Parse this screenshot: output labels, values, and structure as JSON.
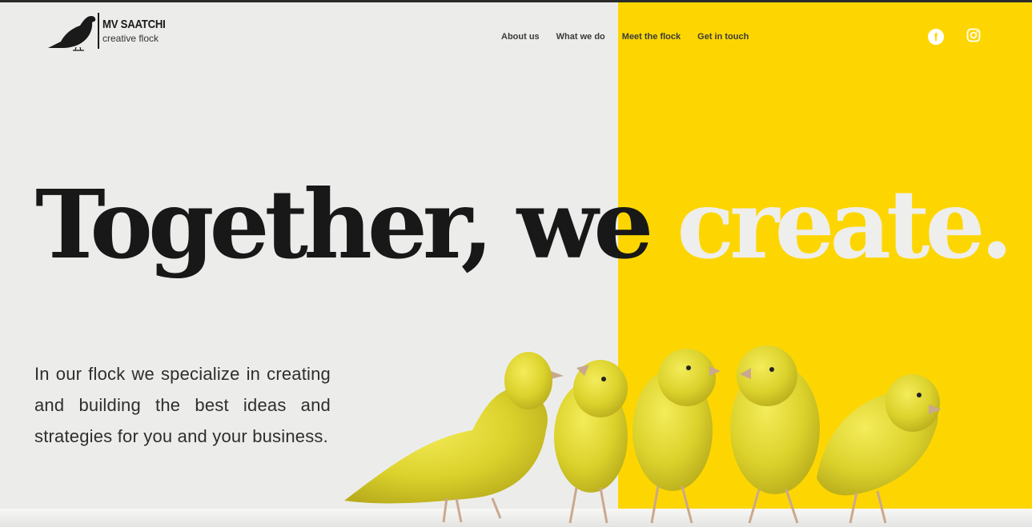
{
  "brand": {
    "name": "MV SAATCHI",
    "tagline": "creative flock",
    "logo_icon": "bird-silhouette-icon"
  },
  "nav": {
    "items": [
      {
        "label": "About us"
      },
      {
        "label": "What we do"
      },
      {
        "label": "Meet the flock"
      },
      {
        "label": "Get in touch"
      }
    ]
  },
  "social": {
    "facebook_icon": "facebook-icon",
    "instagram_icon": "instagram-icon"
  },
  "hero": {
    "headline_dark": "Together, we",
    "headline_light": " create.",
    "intro": "In our flock we specialize in creating and building the best ideas and strategies for you and your business."
  },
  "colors": {
    "accent_yellow": "#fdd602",
    "background": "#ecedeb",
    "text_dark": "#181818"
  }
}
